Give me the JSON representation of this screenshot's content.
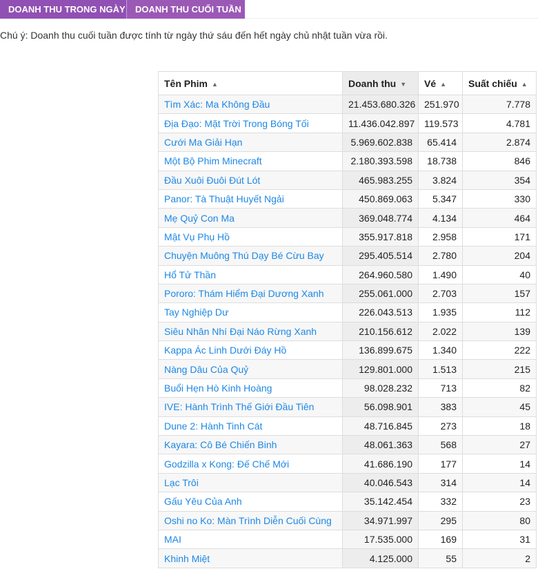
{
  "tabs": [
    {
      "label": "DOANH THU TRONG NGÀY"
    },
    {
      "label": "DOANH THU CUỐI TUẦN"
    }
  ],
  "note": "Chú ý: Doanh thu cuối tuần được tính từ ngày thứ sáu đến hết ngày chủ nhật tuần vừa rồi.",
  "table": {
    "headers": {
      "name": "Tên Phim",
      "revenue": "Doanh thu",
      "tickets": "Vé",
      "shows": "Suất chiếu"
    },
    "sort_icons": {
      "name": "▲",
      "revenue": "▼",
      "tickets": "▲",
      "shows": "▲"
    },
    "rows": [
      {
        "name": "Tìm Xác: Ma Không Đầu",
        "revenue": "21.453.680.326",
        "tickets": "251.970",
        "shows": "7.778"
      },
      {
        "name": "Địa Đạo: Mặt Trời Trong Bóng Tối",
        "revenue": "11.436.042.897",
        "tickets": "119.573",
        "shows": "4.781"
      },
      {
        "name": "Cưới Ma Giải Hạn",
        "revenue": "5.969.602.838",
        "tickets": "65.414",
        "shows": "2.874"
      },
      {
        "name": "Một Bộ Phim Minecraft",
        "revenue": "2.180.393.598",
        "tickets": "18.738",
        "shows": "846"
      },
      {
        "name": "Đầu Xuôi Đuôi Đút Lót",
        "revenue": "465.983.255",
        "tickets": "3.824",
        "shows": "354"
      },
      {
        "name": "Panor: Tà Thuật Huyết Ngải",
        "revenue": "450.869.063",
        "tickets": "5.347",
        "shows": "330"
      },
      {
        "name": "Mẹ Quỷ Con Ma",
        "revenue": "369.048.774",
        "tickets": "4.134",
        "shows": "464"
      },
      {
        "name": "Mật Vụ Phụ Hồ",
        "revenue": "355.917.818",
        "tickets": "2.958",
        "shows": "171"
      },
      {
        "name": "Chuyện Muông Thú Dạy Bé Cừu Bay",
        "revenue": "295.405.514",
        "tickets": "2.780",
        "shows": "204"
      },
      {
        "name": "Hổ Tử Thần",
        "revenue": "264.960.580",
        "tickets": "1.490",
        "shows": "40"
      },
      {
        "name": "Pororo: Thám Hiểm Đại Dương Xanh",
        "revenue": "255.061.000",
        "tickets": "2.703",
        "shows": "157"
      },
      {
        "name": "Tay Nghiệp Dư",
        "revenue": "226.043.513",
        "tickets": "1.935",
        "shows": "112"
      },
      {
        "name": "Siêu Nhân Nhí Đại Náo Rừng Xanh",
        "revenue": "210.156.612",
        "tickets": "2.022",
        "shows": "139"
      },
      {
        "name": "Kappa Ác Linh Dưới Đáy Hồ",
        "revenue": "136.899.675",
        "tickets": "1.340",
        "shows": "222"
      },
      {
        "name": "Nàng Dâu Của Quỷ",
        "revenue": "129.801.000",
        "tickets": "1.513",
        "shows": "215"
      },
      {
        "name": "Buổi Hẹn Hò Kinh Hoàng",
        "revenue": "98.028.232",
        "tickets": "713",
        "shows": "82"
      },
      {
        "name": "IVE: Hành Trình Thế Giới Đầu Tiên",
        "revenue": "56.098.901",
        "tickets": "383",
        "shows": "45"
      },
      {
        "name": "Dune 2: Hành Tinh Cát",
        "revenue": "48.716.845",
        "tickets": "273",
        "shows": "18"
      },
      {
        "name": "Kayara: Cô Bé Chiến Binh",
        "revenue": "48.061.363",
        "tickets": "568",
        "shows": "27"
      },
      {
        "name": "Godzilla x Kong: Đế Chế Mới",
        "revenue": "41.686.190",
        "tickets": "177",
        "shows": "14"
      },
      {
        "name": "Lạc Trôi",
        "revenue": "40.046.543",
        "tickets": "314",
        "shows": "14"
      },
      {
        "name": "Gấu Yêu Của Anh",
        "revenue": "35.142.454",
        "tickets": "332",
        "shows": "23"
      },
      {
        "name": "Oshi no Ko: Màn Trình Diễn Cuối Cùng",
        "revenue": "34.971.997",
        "tickets": "295",
        "shows": "80"
      },
      {
        "name": "MAI",
        "revenue": "17.535.000",
        "tickets": "169",
        "shows": "31"
      },
      {
        "name": "Khinh Miệt",
        "revenue": "4.125.000",
        "tickets": "55",
        "shows": "2"
      }
    ]
  },
  "colors": {
    "tab_bg": "#9b59b6",
    "link": "#1e88e5"
  }
}
